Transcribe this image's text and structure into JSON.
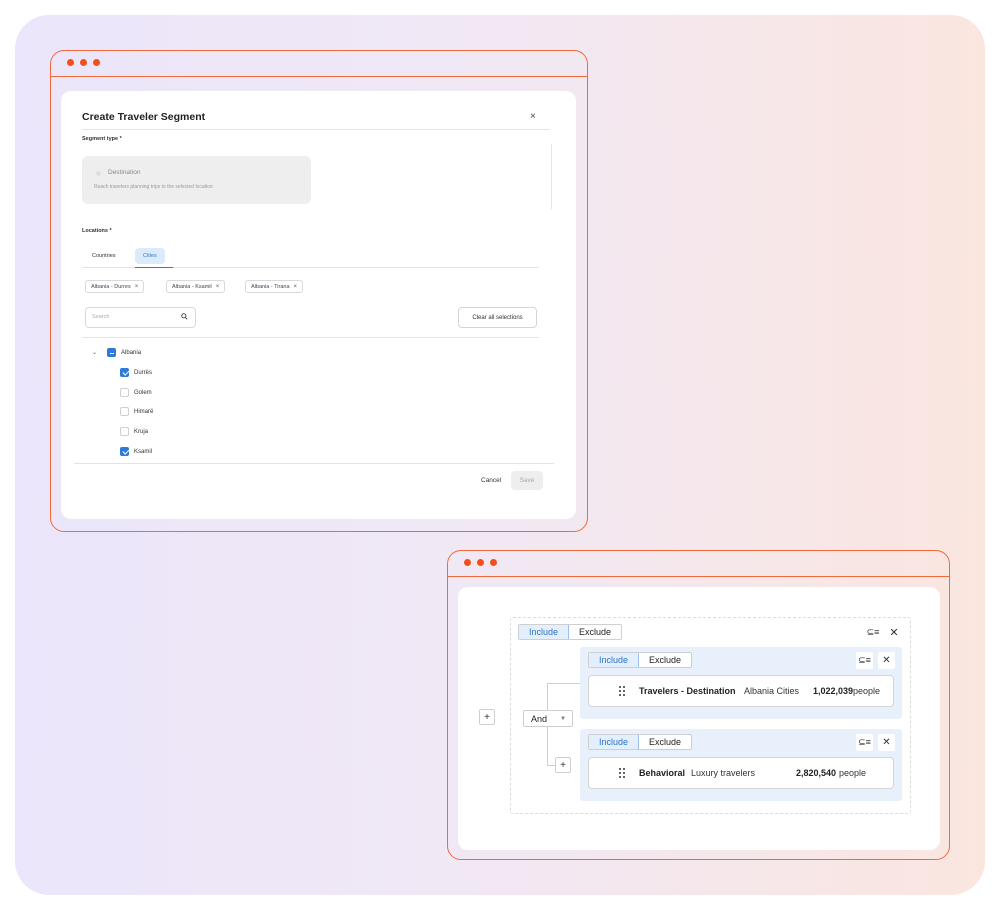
{
  "modal": {
    "title": "Create Traveler Segment",
    "close": "×",
    "segment_type_label": "Segment type *",
    "segment_option_title": "Destination",
    "segment_option_desc": "Reach travelers planning trips to the selected location",
    "locations_label": "Locations *",
    "tabs": [
      "Countries",
      "Cities"
    ],
    "active_tab": "Cities",
    "chips": [
      "Albania - Durres",
      "Albania - Ksamil",
      "Albania - Tirana"
    ],
    "search_placeholder": "Search",
    "clear_all_label": "Clear all selections",
    "tree": {
      "parent": "Albania",
      "children": [
        {
          "label": "Durrës",
          "checked": true
        },
        {
          "label": "Golem",
          "checked": false
        },
        {
          "label": "Himarë",
          "checked": false
        },
        {
          "label": "Kruja",
          "checked": false
        },
        {
          "label": "Ksamil",
          "checked": true
        }
      ]
    },
    "cancel_label": "Cancel",
    "save_label": "Save"
  },
  "builder": {
    "include_label": "Include",
    "exclude_label": "Exclude",
    "operator": "And",
    "rules": [
      {
        "category": "Travelers - Destination",
        "detail": "Albania Cities",
        "count": "1,022,039",
        "unit": "people"
      },
      {
        "category": "Behavioral",
        "detail": "Luxury travelers",
        "count": "2,820,540",
        "unit": "people"
      }
    ]
  },
  "colors": {
    "accent_orange": "#f24f1b",
    "accent_blue": "#2f7ad6",
    "group_bg": "#e8f1fb"
  }
}
